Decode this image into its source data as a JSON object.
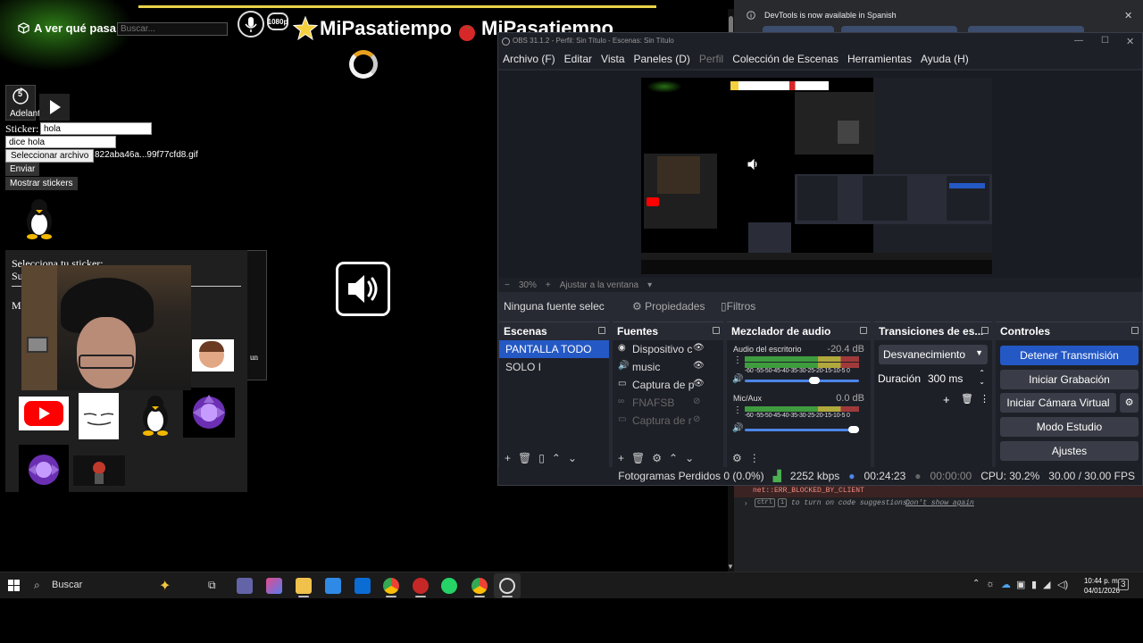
{
  "web": {
    "site_title": "A ver qué pasa",
    "search_placeholder": "Buscar...",
    "resolution_badge": "1080p",
    "brand_1": "MiPasatiempo",
    "brand_2": "MiPasatiempo",
    "forward_label": "Adelant",
    "forward_number": "5",
    "sticker_label": "Sticker:",
    "sticker_input": "hola",
    "says_input": "dice hola",
    "file_button": "Seleccionar archivo",
    "file_name": "822aba46a...99f77cfd8.gif",
    "send_button": "Enviar",
    "show_stickers_button": "Mostrar stickers",
    "panel_title": "Selecciona tu sticker:",
    "panel_line2": "Su",
    "panel_line3": "Me",
    "partial_text": "un"
  },
  "devtools": {
    "notice": "DevTools is now available in Spanish",
    "console_error": "net::ERR_BLOCKED_BY_CLIENT",
    "hint_key1": "ctrl",
    "hint_key2": "i",
    "hint_text": "to turn on code suggestions.",
    "hint_link": "Don't show again"
  },
  "obs": {
    "title": "OBS 31.1.2 - Perfil: Sin Título - Escenas: Sin Título",
    "menu": [
      "Archivo (F)",
      "Editar",
      "Vista",
      "Paneles (D)",
      "Perfil",
      "Colección de Escenas",
      "Herramientas",
      "Ayuda (H)"
    ],
    "zoom": "30%",
    "fit_window": "Ajustar a la ventana",
    "no_source": "Ninguna fuente selec",
    "properties": "Propiedades",
    "filters": "Filtros",
    "scenes_title": "Escenas",
    "scenes": [
      "PANTALLA TODO",
      "SOLO I"
    ],
    "sources_title": "Fuentes",
    "sources": [
      "Dispositivo c",
      "music",
      "Captura de p",
      "FNAFSB",
      "Captura de r"
    ],
    "mixer_title": "Mezclador de audio",
    "mixer": [
      {
        "name": "Audio del escritorio",
        "db": "-20.4 dB",
        "volume": 0.62
      },
      {
        "name": "Mic/Aux",
        "db": "0.0 dB",
        "volume": 1.0
      }
    ],
    "meter_scale": "-60 -55-50-45-40-35-30-25-20-15-10-5 0",
    "transitions_title": "Transiciones de es...",
    "transition": "Desvanecimiento",
    "duration_label": "Duración",
    "duration_value": "300 ms",
    "controls_title": "Controles",
    "controls": [
      "Detener Transmisión",
      "Iniciar Grabación",
      "Iniciar Cámara Virtual",
      "Modo Estudio",
      "Ajustes"
    ],
    "status": {
      "dropped": "Fotogramas Perdidos 0 (0.0%)",
      "bitrate": "2252 kbps",
      "stream_time": "00:24:23",
      "rec_time": "00:00:00",
      "cpu": "CPU: 30.2%",
      "fps": "30.00 / 30.00 FPS"
    }
  },
  "taskbar": {
    "search": "Buscar",
    "time": "10:44 p. m.",
    "date": "04/01/2026",
    "notif_count": "3"
  },
  "colors": {
    "obs_accent": "#2458c4",
    "progress": "#e8d24a",
    "taskbar": "#1b1b1b"
  }
}
